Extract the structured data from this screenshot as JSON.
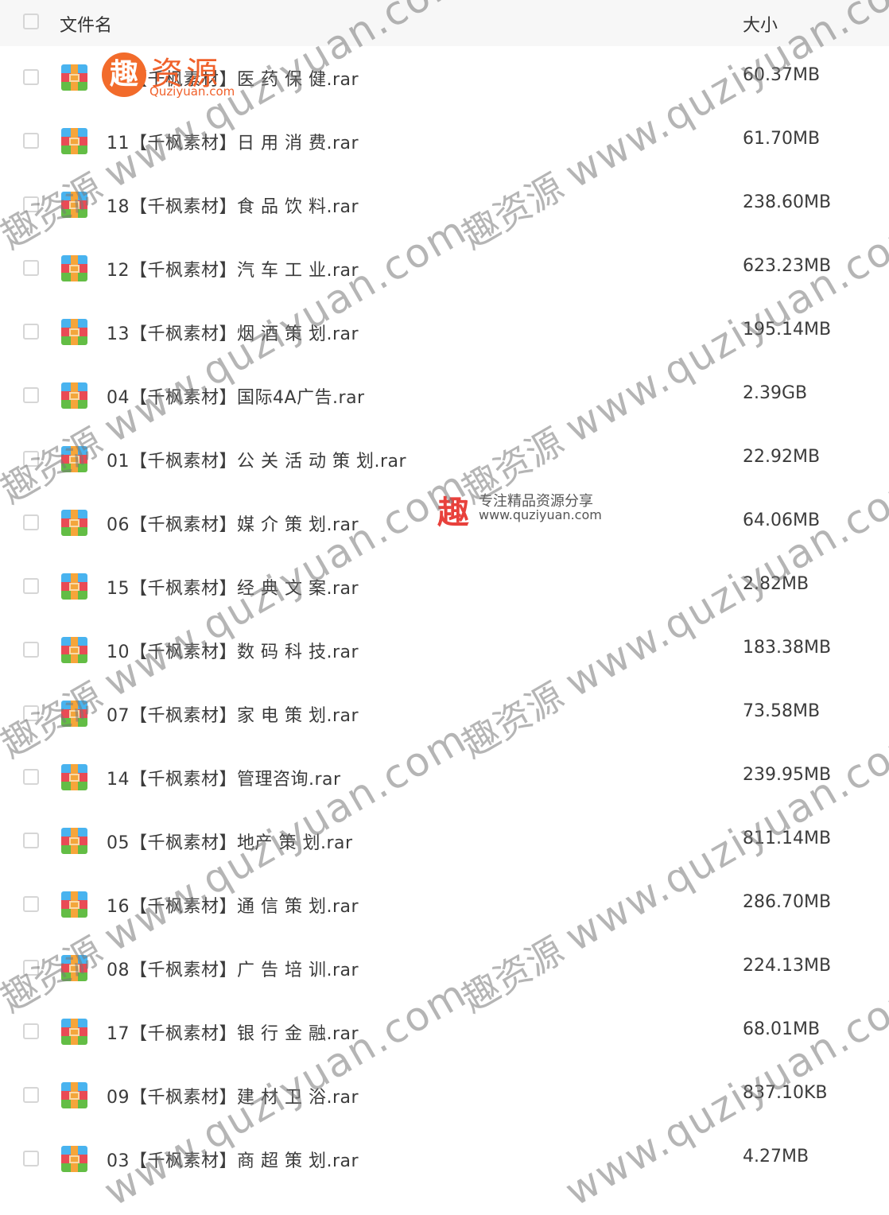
{
  "header": {
    "name_label": "文件名",
    "size_label": "大小"
  },
  "files": [
    {
      "name": "02【千枫素材】医 药 保 健.rar",
      "size": "60.37MB"
    },
    {
      "name": "11【千枫素材】日 用 消 费.rar",
      "size": "61.70MB"
    },
    {
      "name": "18【千枫素材】食 品 饮 料.rar",
      "size": "238.60MB"
    },
    {
      "name": "12【千枫素材】汽 车 工 业.rar",
      "size": "623.23MB"
    },
    {
      "name": "13【千枫素材】烟 酒 策 划.rar",
      "size": "195.14MB"
    },
    {
      "name": "04【千枫素材】国际4A广告.rar",
      "size": "2.39GB"
    },
    {
      "name": "01【千枫素材】公 关 活 动 策 划.rar",
      "size": "22.92MB"
    },
    {
      "name": "06【千枫素材】媒 介 策 划.rar",
      "size": "64.06MB"
    },
    {
      "name": "15【千枫素材】经 典 文 案.rar",
      "size": "2.82MB"
    },
    {
      "name": "10【千枫素材】数 码 科 技.rar",
      "size": "183.38MB"
    },
    {
      "name": "07【千枫素材】家 电 策 划.rar",
      "size": "73.58MB"
    },
    {
      "name": "14【千枫素材】管理咨询.rar",
      "size": "239.95MB"
    },
    {
      "name": "05【千枫素材】地产 策 划.rar",
      "size": "811.14MB"
    },
    {
      "name": "16【千枫素材】通 信 策 划.rar",
      "size": "286.70MB"
    },
    {
      "name": "08【千枫素材】广 告 培 训.rar",
      "size": "224.13MB"
    },
    {
      "name": "17【千枫素材】银 行 金 融.rar",
      "size": "68.01MB"
    },
    {
      "name": "09【千枫素材】建 材 卫 浴.rar",
      "size": "837.10KB"
    },
    {
      "name": "03【千枫素材】商 超 策 划.rar",
      "size": "4.27MB"
    }
  ],
  "watermark": {
    "url": "www.quziyuan.com",
    "cn": "趣资源",
    "logo_glyph": "趣",
    "logo_title": "资源",
    "logo_sub": "Quziyuan.com",
    "center_glyph": "趣",
    "center_line1": "专注精品资源分享",
    "center_line2": "www.quziyuan.com",
    "brand_color": "#f0612b"
  }
}
